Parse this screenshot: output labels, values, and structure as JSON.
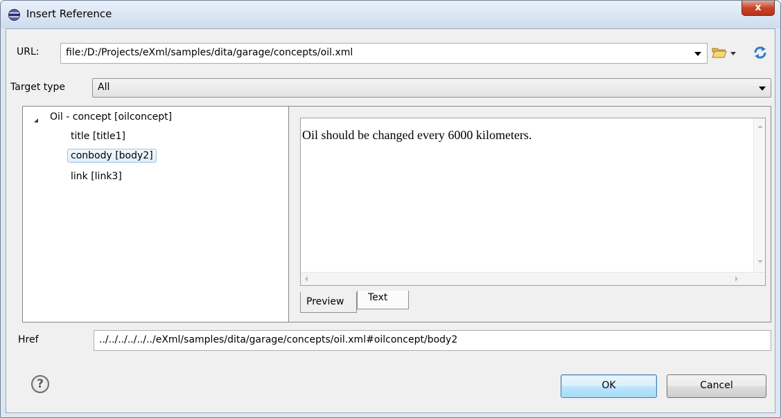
{
  "window": {
    "title": "Insert Reference",
    "close_label": "x"
  },
  "url": {
    "label": "URL:",
    "value": "file:/D:/Projects/eXml/samples/dita/garage/concepts/oil.xml"
  },
  "toolbar": {
    "browse_icon": "folder-open-icon",
    "dropdown_icon": "chevron-down-icon",
    "reload_icon": "refresh-icon"
  },
  "target_type": {
    "label": "Target type",
    "value": "All"
  },
  "tree": {
    "root": "Oil - concept [oilconcept]",
    "children": [
      "title [title1]",
      "conbody [body2]",
      "link [link3]"
    ],
    "selected_index": 1
  },
  "preview": {
    "text": "Oil should be changed every 6000 kilometers.",
    "tabs": [
      "Preview",
      "Text"
    ],
    "active_tab": "Preview"
  },
  "href": {
    "label": "Href",
    "value": "../../../../../../eXml/samples/dita/garage/concepts/oil.xml#oilconcept/body2"
  },
  "buttons": {
    "help": "?",
    "ok": "OK",
    "cancel": "Cancel"
  }
}
